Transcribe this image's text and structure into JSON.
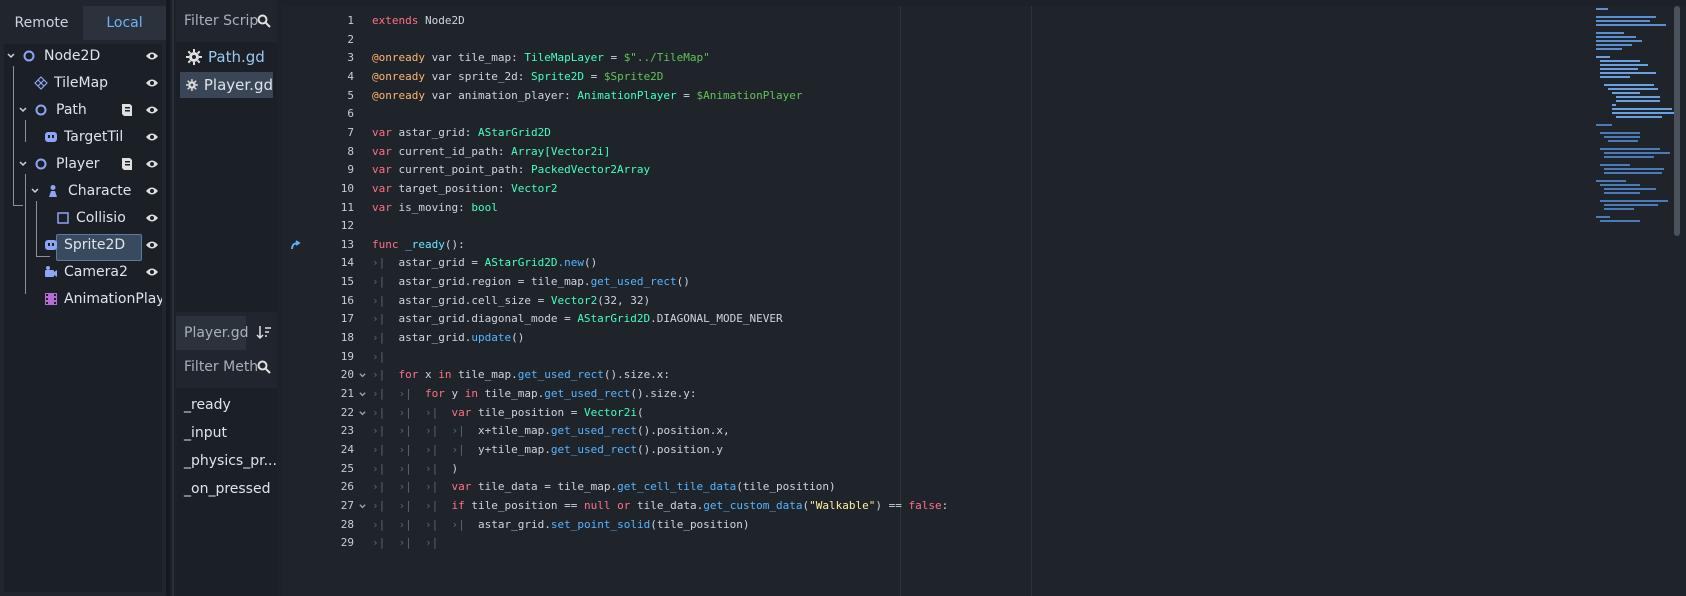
{
  "scene_dock": {
    "tabs": [
      {
        "label": "Remote"
      },
      {
        "label": "Local"
      }
    ],
    "tree": [
      {
        "name": "Node2D",
        "icon": "node2d-icon",
        "fold": true
      },
      {
        "name": "TileMap",
        "icon": "tilemap-icon"
      },
      {
        "name": "Path",
        "icon": "node2d-icon",
        "fold": true,
        "script": true
      },
      {
        "name": "TargetTil",
        "icon": "sprite-icon"
      },
      {
        "name": "Player",
        "icon": "node2d-icon",
        "fold": true,
        "script": true
      },
      {
        "name": "Characte",
        "icon": "character-icon",
        "fold": true
      },
      {
        "name": "Collisio",
        "icon": "collision-icon"
      },
      {
        "name": "Sprite2D",
        "icon": "sprite-icon"
      },
      {
        "name": "Camera2",
        "icon": "camera-icon"
      },
      {
        "name": "AnimationPlay",
        "icon": "animation-icon"
      }
    ]
  },
  "scripts_panel": {
    "filter_placeholder": "Filter Scrip",
    "scripts": [
      {
        "label": "Path.gd"
      },
      {
        "label": "Player.gd"
      }
    ],
    "current_script": "Player.gd",
    "method_filter_placeholder": "Filter Meth",
    "methods": [
      "_ready",
      "_input",
      "_physics_pr...",
      "_on_pressed"
    ]
  },
  "editor": {
    "lines": [
      {
        "n": "1",
        "tokens": [
          [
            "kw",
            "extends"
          ],
          [
            "",
            "Node2D"
          ]
        ]
      },
      {
        "n": "2",
        "tokens": []
      },
      {
        "n": "3",
        "tokens": [
          [
            "an",
            "@onready"
          ],
          [
            "",
            "var"
          ],
          [
            "",
            "tile_map:"
          ],
          [
            "ty",
            "TileMapLayer"
          ],
          [
            "",
            "="
          ],
          [
            "nd",
            "$\"../TileMap\""
          ]
        ]
      },
      {
        "n": "4",
        "tokens": [
          [
            "an",
            "@onready"
          ],
          [
            "",
            "var"
          ],
          [
            "",
            "sprite_2d:"
          ],
          [
            "ty",
            "Sprite2D"
          ],
          [
            "",
            "="
          ],
          [
            "nd",
            "$Sprite2D"
          ]
        ]
      },
      {
        "n": "5",
        "tokens": [
          [
            "an",
            "@onready"
          ],
          [
            "",
            "var"
          ],
          [
            "",
            "animation_player:"
          ],
          [
            "ty",
            "AnimationPlayer"
          ],
          [
            "",
            "="
          ],
          [
            "nd",
            "$AnimationPlayer"
          ]
        ]
      },
      {
        "n": "6",
        "tokens": []
      },
      {
        "n": "7",
        "tokens": [
          [
            "kw",
            "var"
          ],
          [
            "",
            "astar_grid:"
          ],
          [
            "ty",
            "AStarGrid2D"
          ]
        ]
      },
      {
        "n": "8",
        "tokens": [
          [
            "kw",
            "var"
          ],
          [
            "",
            "current_id_path:"
          ],
          [
            "ty",
            "Array[Vector2i]"
          ]
        ]
      },
      {
        "n": "9",
        "tokens": [
          [
            "kw",
            "var"
          ],
          [
            "",
            "current_point_path:"
          ],
          [
            "ty",
            "PackedVector2Array"
          ]
        ]
      },
      {
        "n": "10",
        "tokens": [
          [
            "kw",
            "var"
          ],
          [
            "",
            "target_position:"
          ],
          [
            "ty",
            "Vector2"
          ]
        ]
      },
      {
        "n": "11",
        "tokens": [
          [
            "kw",
            "var"
          ],
          [
            "",
            "is_moving:"
          ],
          [
            "ty",
            "bool"
          ]
        ]
      },
      {
        "n": "12",
        "tokens": []
      },
      {
        "n": "13",
        "tokens": [
          [
            "kw",
            "func"
          ],
          [
            "fo",
            "_ready"
          ],
          [
            "",
            "():"
          ]
        ]
      },
      {
        "n": "14",
        "tokens": [
          [
            "",
            "astar_grid ="
          ],
          [
            "ty",
            "AStarGrid2D"
          ],
          [
            "fn",
            ".new"
          ],
          [
            "",
            "()"
          ]
        ],
        "indent": 1
      },
      {
        "n": "15",
        "tokens": [
          [
            "",
            "astar_grid.region = tile_map."
          ],
          [
            "fn",
            "get_used_rect"
          ],
          [
            "",
            "()"
          ]
        ],
        "indent": 1
      },
      {
        "n": "16",
        "tokens": [
          [
            "",
            "astar_grid.cell_size ="
          ],
          [
            "ty",
            "Vector2"
          ],
          [
            "",
            "(32, 32)"
          ]
        ],
        "indent": 1
      },
      {
        "n": "17",
        "tokens": [
          [
            "",
            "astar_grid.diagonal_mode ="
          ],
          [
            "ty",
            "AStarGrid2D"
          ],
          [
            "",
            ".DIAGONAL_MODE_NEVER"
          ]
        ],
        "indent": 1
      },
      {
        "n": "18",
        "tokens": [
          [
            "",
            "astar_grid."
          ],
          [
            "fn",
            "update"
          ],
          [
            "",
            "()"
          ]
        ],
        "indent": 1
      },
      {
        "n": "19",
        "tokens": [],
        "indent": 1
      },
      {
        "n": "20",
        "tokens": [
          [
            "kw",
            "for"
          ],
          [
            "",
            "x"
          ],
          [
            "kw",
            "in"
          ],
          [
            "",
            "tile_map."
          ],
          [
            "fn",
            "get_used_rect"
          ],
          [
            "",
            "().size.x:"
          ]
        ],
        "indent": 1,
        "fold": true
      },
      {
        "n": "21",
        "tokens": [
          [
            "kw",
            "for"
          ],
          [
            "",
            "y"
          ],
          [
            "kw",
            "in"
          ],
          [
            "",
            "tile_map."
          ],
          [
            "fn",
            "get_used_rect"
          ],
          [
            "",
            "().size.y:"
          ]
        ],
        "indent": 2,
        "fold": true
      },
      {
        "n": "22",
        "tokens": [
          [
            "kw",
            "var"
          ],
          [
            "",
            "tile_position ="
          ],
          [
            "ty",
            "Vector2i"
          ],
          [
            "",
            "("
          ]
        ],
        "indent": 3,
        "fold": true
      },
      {
        "n": "23",
        "tokens": [
          [
            "",
            "x+tile_map."
          ],
          [
            "fn",
            "get_used_rect"
          ],
          [
            "",
            "().position.x,"
          ]
        ],
        "indent": 4
      },
      {
        "n": "24",
        "tokens": [
          [
            "",
            "y+tile_map."
          ],
          [
            "fn",
            "get_used_rect"
          ],
          [
            "",
            "().position.y"
          ]
        ],
        "indent": 4
      },
      {
        "n": "25",
        "tokens": [
          [
            "",
            ")"
          ]
        ],
        "indent": 3
      },
      {
        "n": "26",
        "tokens": [
          [
            "kw",
            "var"
          ],
          [
            "",
            "tile_data = tile_map."
          ],
          [
            "fn",
            "get_cell_tile_data"
          ],
          [
            "",
            "(tile_position)"
          ]
        ],
        "indent": 3
      },
      {
        "n": "27",
        "tokens": [
          [
            "kw",
            "if"
          ],
          [
            "",
            "tile_position =="
          ],
          [
            "kw",
            "null"
          ],
          [
            "kw",
            "or"
          ],
          [
            "",
            "tile_data."
          ],
          [
            "fn",
            "get_custom_data"
          ],
          [
            "",
            "("
          ],
          [
            "st",
            "\"Walkable\""
          ],
          [
            "",
            ") =="
          ],
          [
            "kw",
            "false"
          ],
          [
            "",
            ":"
          ]
        ],
        "indent": 3,
        "fold": true
      },
      {
        "n": "28",
        "tokens": [
          [
            "",
            "astar_grid."
          ],
          [
            "fn",
            "set_point_solid"
          ],
          [
            "",
            "(tile_position)"
          ]
        ],
        "indent": 4
      },
      {
        "n": "29",
        "tokens": [],
        "indent": 3
      }
    ]
  }
}
